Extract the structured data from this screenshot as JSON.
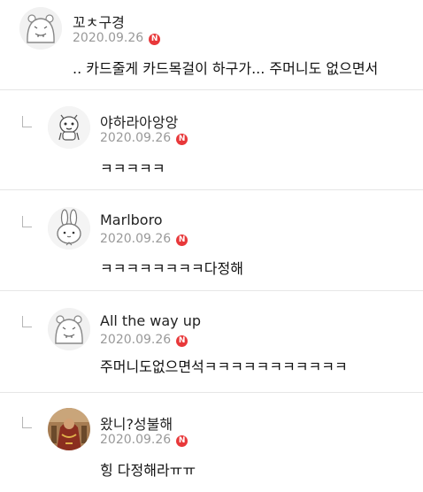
{
  "comments": [
    {
      "nickname": "꼬ㅊ구경",
      "date": "2020.09.26",
      "new_badge": "N",
      "text": ".. 카드줄게 카드목걸이 하구가... 주머니도 없으면서",
      "avatar_icon": "hippo-avatar-icon"
    },
    {
      "nickname": "야하라아앙앙",
      "date": "2020.09.26",
      "new_badge": "N",
      "text": "ㅋㅋㅋㅋㅋ",
      "avatar_icon": "cartoon-character-avatar-icon"
    },
    {
      "nickname": "Marlboro",
      "date": "2020.09.26",
      "new_badge": "N",
      "text": "ㅋㅋㅋㅋㅋㅋㅋㅋ다정해",
      "avatar_icon": "bunny-avatar-icon"
    },
    {
      "nickname": "All the way up",
      "date": "2020.09.26",
      "new_badge": "N",
      "text": "주머니도없으면석ㅋㅋㅋㅋㅋㅋㅋㅋㅋㅋㅋ",
      "avatar_icon": "hippo-avatar-icon"
    },
    {
      "nickname": "왔니?성불해",
      "date": "2020.09.26",
      "new_badge": "N",
      "text": "힝 다정해라ㅠㅠ",
      "avatar_icon": "photo-avatar-icon"
    }
  ],
  "colors": {
    "badge": "#e8383a",
    "divider": "#e6e6e6",
    "date": "#999999",
    "reply_arrow": "#b5b5b5"
  }
}
